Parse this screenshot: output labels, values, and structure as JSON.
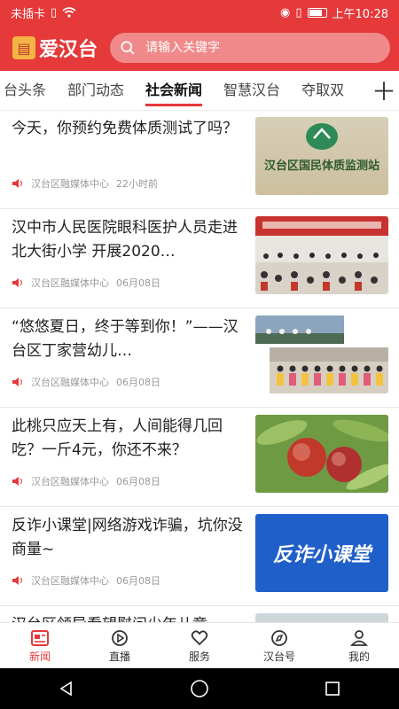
{
  "status_bar": {
    "carrier": "未插卡",
    "time": "上午10:28"
  },
  "header": {
    "app_name": "爱汉台",
    "search_placeholder": "请输入关键字"
  },
  "tabs": [
    "台头条",
    "部门动态",
    "社会新闻",
    "智慧汉台",
    "夺取双"
  ],
  "active_tab": "社会新闻",
  "news": [
    {
      "title": "今天，你预约免费体质测试了吗？",
      "source": "汉台区融媒体中心",
      "time": "22小时前",
      "thumb_text": "汉台区国民体质监测站",
      "thumb_type": "sign"
    },
    {
      "title": "汉中市人民医院眼科医护人员走进北大街小学 开展2020…",
      "source": "汉台区融媒体中心",
      "time": "06月08日",
      "thumb_type": "hall"
    },
    {
      "title": "“悠悠夏日，终于等到你！”——汉台区丁家营幼儿…",
      "source": "汉台区融媒体中心",
      "time": "06月08日",
      "thumb_type": "kids"
    },
    {
      "title": "此桃只应天上有，人间能得几回吃？一斤4元，你还不来？",
      "source": "汉台区融媒体中心",
      "time": "06月08日",
      "thumb_type": "peach"
    },
    {
      "title": "反诈小课堂|网络游戏诈骗，坑你没商量~",
      "source": "汉台区融媒体中心",
      "time": "06月08日",
      "thumb_text": "反诈小课堂",
      "thumb_type": "banner"
    },
    {
      "title": "汉台区领导看望慰问少年儿童",
      "source": "",
      "time": "",
      "thumb_type": "partial"
    }
  ],
  "bottom_nav": [
    {
      "label": "新闻",
      "icon": "news-icon",
      "active": true
    },
    {
      "label": "直播",
      "icon": "play-icon",
      "active": false
    },
    {
      "label": "服务",
      "icon": "service-icon",
      "active": false
    },
    {
      "label": "汉台号",
      "icon": "compass-icon",
      "active": false
    },
    {
      "label": "我的",
      "icon": "user-icon",
      "active": false
    }
  ],
  "colors": {
    "brand_red": "#e5393a"
  }
}
